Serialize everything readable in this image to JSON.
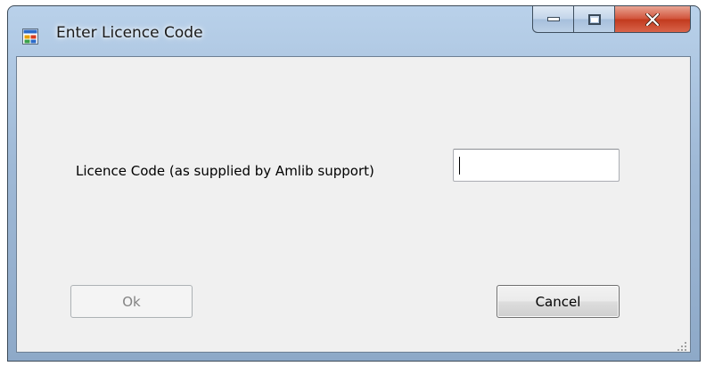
{
  "window": {
    "title": "Enter Licence Code",
    "icon": "app-window-icon",
    "controls": {
      "minimize": "minimize-icon",
      "maximize": "maximize-icon",
      "close": "close-icon"
    }
  },
  "form": {
    "licence_label": "Licence Code (as supplied by Amlib support)",
    "licence_value": "",
    "licence_placeholder": ""
  },
  "buttons": {
    "ok_label": "Ok",
    "ok_enabled": false,
    "cancel_label": "Cancel"
  },
  "colors": {
    "title_glass": "#b9d1ea",
    "close_red": "#c23a1e",
    "client_bg": "#f0f0f0"
  }
}
